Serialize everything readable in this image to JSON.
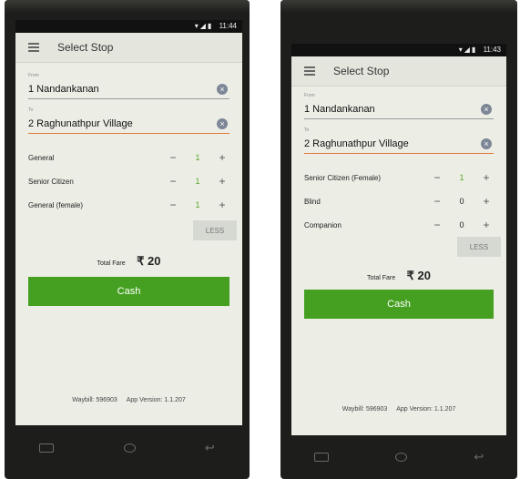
{
  "status_time_left": "11:44",
  "status_time_right": "11:43",
  "app_title": "Select Stop",
  "from_label": "From",
  "to_label": "To",
  "from_stop": "1 Nandankanan",
  "to_stop": "2 Raghunathpur Village",
  "left_screen": {
    "passengers": [
      {
        "label": "General",
        "count": "1"
      },
      {
        "label": "Senior Citizen",
        "count": "1"
      },
      {
        "label": "General (female)",
        "count": "1"
      }
    ]
  },
  "right_screen": {
    "passengers": [
      {
        "label": "Senior Citizen (Female)",
        "count": "1"
      },
      {
        "label": "Blind",
        "count": "0"
      },
      {
        "label": "Companion",
        "count": "0"
      }
    ]
  },
  "less_label": "LESS",
  "total_fare_label": "Total Fare",
  "total_fare_value": "₹ 20",
  "cash_label": "Cash",
  "waybill": "Waybill: 596903",
  "app_version": "App Version: 1.1.207",
  "icons": {
    "menu": "hamburger-icon",
    "clear": "clear-icon",
    "minus": "minus-icon",
    "plus": "plus-icon",
    "recent": "recent-apps-icon",
    "home": "home-icon",
    "back": "back-icon"
  },
  "colors": {
    "accent_green": "#45a022",
    "count_green": "#5aa426",
    "active_underline": "#e07a3a"
  }
}
